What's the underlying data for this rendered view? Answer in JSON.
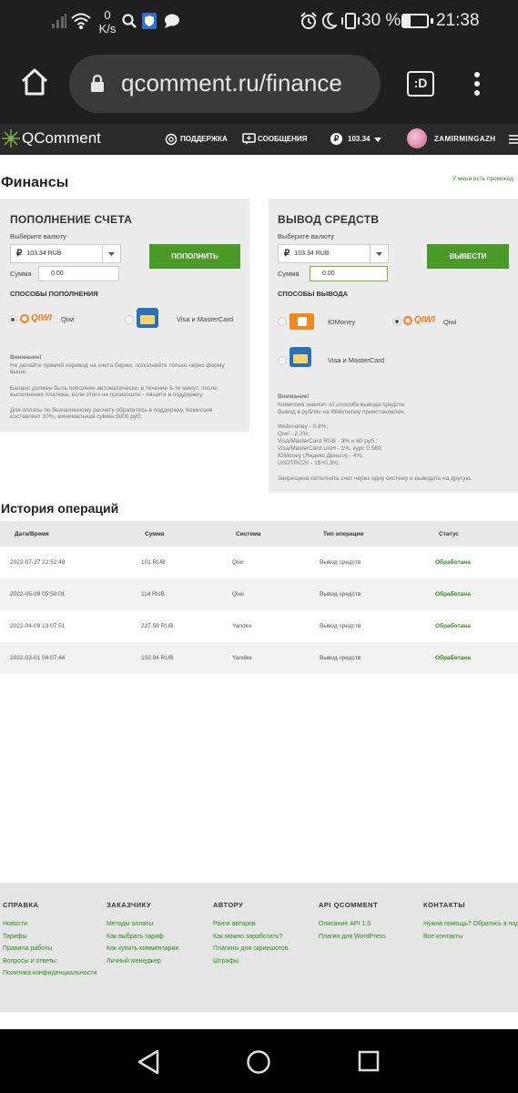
{
  "status_bar": {
    "speed_value": "0",
    "speed_unit": "K/s",
    "battery": "30 %",
    "time": "21:38"
  },
  "browser": {
    "url": "qcomment.ru/finance",
    "tab_icon": ":D"
  },
  "nav": {
    "logo": "QComment",
    "support": "ПОДДЕРЖКА",
    "messages": "СООБЩЕНИЯ",
    "balance": "103.34",
    "username": "ZAMIRMINGAZH"
  },
  "page": {
    "title": "Финансы",
    "promo_link": "У меня есть промокод"
  },
  "deposit": {
    "title": "ПОПОЛНЕНИЕ СЧЕТА",
    "currency_label": "Выберите валюту",
    "currency_value": "103.34 RUB",
    "amount_label": "Сумма",
    "amount_value": "0.00",
    "button": "ПОПОЛНИТЬ",
    "methods_title": "СПОСОБЫ ПОПОЛНЕНИЯ",
    "methods": [
      {
        "name": "Qiwi"
      },
      {
        "name": "Visa и MasterCard"
      }
    ],
    "qiwi_logo": "QIWI",
    "notice_title": "Внимание!",
    "notice_1": "Не делайте прямой перевод на счета биржи, пополняйте только через форму выше.",
    "notice_2": "Баланс должен быть пополнен автоматически, в течение 5-ти минут, после выполнения платежа, если этого не произошло - пишите в поддержку.",
    "notice_3": "Для оплаты по безналичному расчету обратитесь в поддержку. Комиссия составляет 10%, минимальная сумма 5000 руб."
  },
  "withdraw": {
    "title": "ВЫВОД СРЕДСТВ",
    "currency_label": "Выберите валюту",
    "currency_value": "103.34 RUB",
    "amount_label": "Сумма",
    "amount_value": "0.00",
    "button": "ВЫВЕСТИ",
    "methods_title": "СПОСОБЫ ВЫВОДА",
    "methods": [
      {
        "name": "ЮMoney"
      },
      {
        "name": "Qiwi"
      },
      {
        "name": "Visa и MasterCard"
      }
    ],
    "qiwi_logo": "QIWI",
    "notice_title": "Внимание!",
    "notice_lines": [
      "Комиссия зависит от способа вывода средств.",
      "Вывод в рублях на Webmoney приостановлен."
    ],
    "fees": [
      "Webmoney - 0.8%;",
      "Qiwi - 2.2%;",
      "Visa/MasterCard RUB - 3% и 60 руб.;",
      "Visa/MasterCard UAH - 1%, курс 0.569;",
      "ЮMoney (Яндекс.Деньги) - 4%;",
      "USDTRC20 - 1$+0.3%;"
    ],
    "footer_note": "Запрещено пополнять счет через одну систему и выводить на другую."
  },
  "history": {
    "title": "История операций",
    "columns": [
      "Дата/Время",
      "Сумма",
      "Система",
      "Тип операции",
      "Статус"
    ],
    "rows": [
      {
        "date": "2022-07-27 22:52:48",
        "amount": "101 RUB",
        "system": "Qiwi",
        "type": "Вывод средств",
        "status": "Обработана"
      },
      {
        "date": "2022-05-09 05:50:01",
        "amount": "114 RUB",
        "system": "Qiwi",
        "type": "Вывод средств",
        "status": "Обработана"
      },
      {
        "date": "2022-04-09 13:07:51",
        "amount": "227.58 RUB",
        "system": "Yandex",
        "type": "Вывод средств",
        "status": "Обработана"
      },
      {
        "date": "2022-03-01 04:07:44",
        "amount": "102.94 RUB",
        "system": "Yandex",
        "type": "Вывод средств",
        "status": "Обработана"
      }
    ]
  },
  "footer": {
    "cols": [
      {
        "title": "СПРАВКА",
        "links": [
          "Новости",
          "Тарифы",
          "Правила работы",
          "Вопросы и ответы",
          "Политика конфиденциальности"
        ]
      },
      {
        "title": "ЗАКАЗЧИКУ",
        "links": [
          "Методы оплаты",
          "Как выбрать тариф",
          "Как купить комментарии",
          "Личный менеджер"
        ]
      },
      {
        "title": "АВТОРУ",
        "links": [
          "Ранги авторов",
          "Как можно заработать?",
          "Плагины для скриншотов",
          "Штрафы"
        ]
      },
      {
        "title": "API QCOMMENT",
        "links": [
          "Описание API 1.5",
          "Плагин для WordPress"
        ]
      },
      {
        "title": "КОНТАКТЫ",
        "links": [
          "Нужна помощь? Обратись в поддержку",
          "Все контакты"
        ]
      }
    ]
  },
  "colors": {
    "accent": "#4a9a2a",
    "link": "#2f8a1e",
    "status_ok": "#2f8a1e"
  }
}
